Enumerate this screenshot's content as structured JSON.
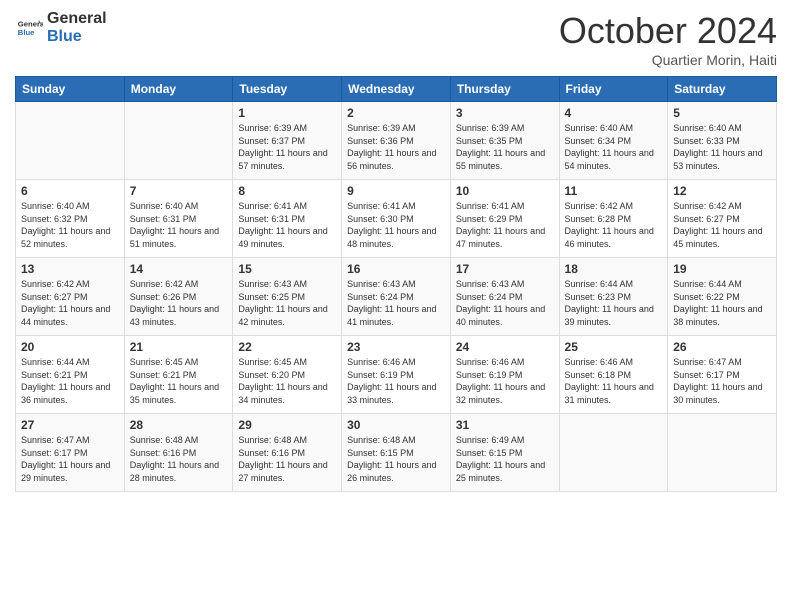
{
  "logo": {
    "general": "General",
    "blue": "Blue"
  },
  "header": {
    "month": "October 2024",
    "location": "Quartier Morin, Haiti"
  },
  "days_of_week": [
    "Sunday",
    "Monday",
    "Tuesday",
    "Wednesday",
    "Thursday",
    "Friday",
    "Saturday"
  ],
  "weeks": [
    [
      {
        "day": "",
        "info": ""
      },
      {
        "day": "",
        "info": ""
      },
      {
        "day": "1",
        "info": "Sunrise: 6:39 AM\nSunset: 6:37 PM\nDaylight: 11 hours and 57 minutes."
      },
      {
        "day": "2",
        "info": "Sunrise: 6:39 AM\nSunset: 6:36 PM\nDaylight: 11 hours and 56 minutes."
      },
      {
        "day": "3",
        "info": "Sunrise: 6:39 AM\nSunset: 6:35 PM\nDaylight: 11 hours and 55 minutes."
      },
      {
        "day": "4",
        "info": "Sunrise: 6:40 AM\nSunset: 6:34 PM\nDaylight: 11 hours and 54 minutes."
      },
      {
        "day": "5",
        "info": "Sunrise: 6:40 AM\nSunset: 6:33 PM\nDaylight: 11 hours and 53 minutes."
      }
    ],
    [
      {
        "day": "6",
        "info": "Sunrise: 6:40 AM\nSunset: 6:32 PM\nDaylight: 11 hours and 52 minutes."
      },
      {
        "day": "7",
        "info": "Sunrise: 6:40 AM\nSunset: 6:31 PM\nDaylight: 11 hours and 51 minutes."
      },
      {
        "day": "8",
        "info": "Sunrise: 6:41 AM\nSunset: 6:31 PM\nDaylight: 11 hours and 49 minutes."
      },
      {
        "day": "9",
        "info": "Sunrise: 6:41 AM\nSunset: 6:30 PM\nDaylight: 11 hours and 48 minutes."
      },
      {
        "day": "10",
        "info": "Sunrise: 6:41 AM\nSunset: 6:29 PM\nDaylight: 11 hours and 47 minutes."
      },
      {
        "day": "11",
        "info": "Sunrise: 6:42 AM\nSunset: 6:28 PM\nDaylight: 11 hours and 46 minutes."
      },
      {
        "day": "12",
        "info": "Sunrise: 6:42 AM\nSunset: 6:27 PM\nDaylight: 11 hours and 45 minutes."
      }
    ],
    [
      {
        "day": "13",
        "info": "Sunrise: 6:42 AM\nSunset: 6:27 PM\nDaylight: 11 hours and 44 minutes."
      },
      {
        "day": "14",
        "info": "Sunrise: 6:42 AM\nSunset: 6:26 PM\nDaylight: 11 hours and 43 minutes."
      },
      {
        "day": "15",
        "info": "Sunrise: 6:43 AM\nSunset: 6:25 PM\nDaylight: 11 hours and 42 minutes."
      },
      {
        "day": "16",
        "info": "Sunrise: 6:43 AM\nSunset: 6:24 PM\nDaylight: 11 hours and 41 minutes."
      },
      {
        "day": "17",
        "info": "Sunrise: 6:43 AM\nSunset: 6:24 PM\nDaylight: 11 hours and 40 minutes."
      },
      {
        "day": "18",
        "info": "Sunrise: 6:44 AM\nSunset: 6:23 PM\nDaylight: 11 hours and 39 minutes."
      },
      {
        "day": "19",
        "info": "Sunrise: 6:44 AM\nSunset: 6:22 PM\nDaylight: 11 hours and 38 minutes."
      }
    ],
    [
      {
        "day": "20",
        "info": "Sunrise: 6:44 AM\nSunset: 6:21 PM\nDaylight: 11 hours and 36 minutes."
      },
      {
        "day": "21",
        "info": "Sunrise: 6:45 AM\nSunset: 6:21 PM\nDaylight: 11 hours and 35 minutes."
      },
      {
        "day": "22",
        "info": "Sunrise: 6:45 AM\nSunset: 6:20 PM\nDaylight: 11 hours and 34 minutes."
      },
      {
        "day": "23",
        "info": "Sunrise: 6:46 AM\nSunset: 6:19 PM\nDaylight: 11 hours and 33 minutes."
      },
      {
        "day": "24",
        "info": "Sunrise: 6:46 AM\nSunset: 6:19 PM\nDaylight: 11 hours and 32 minutes."
      },
      {
        "day": "25",
        "info": "Sunrise: 6:46 AM\nSunset: 6:18 PM\nDaylight: 11 hours and 31 minutes."
      },
      {
        "day": "26",
        "info": "Sunrise: 6:47 AM\nSunset: 6:17 PM\nDaylight: 11 hours and 30 minutes."
      }
    ],
    [
      {
        "day": "27",
        "info": "Sunrise: 6:47 AM\nSunset: 6:17 PM\nDaylight: 11 hours and 29 minutes."
      },
      {
        "day": "28",
        "info": "Sunrise: 6:48 AM\nSunset: 6:16 PM\nDaylight: 11 hours and 28 minutes."
      },
      {
        "day": "29",
        "info": "Sunrise: 6:48 AM\nSunset: 6:16 PM\nDaylight: 11 hours and 27 minutes."
      },
      {
        "day": "30",
        "info": "Sunrise: 6:48 AM\nSunset: 6:15 PM\nDaylight: 11 hours and 26 minutes."
      },
      {
        "day": "31",
        "info": "Sunrise: 6:49 AM\nSunset: 6:15 PM\nDaylight: 11 hours and 25 minutes."
      },
      {
        "day": "",
        "info": ""
      },
      {
        "day": "",
        "info": ""
      }
    ]
  ]
}
